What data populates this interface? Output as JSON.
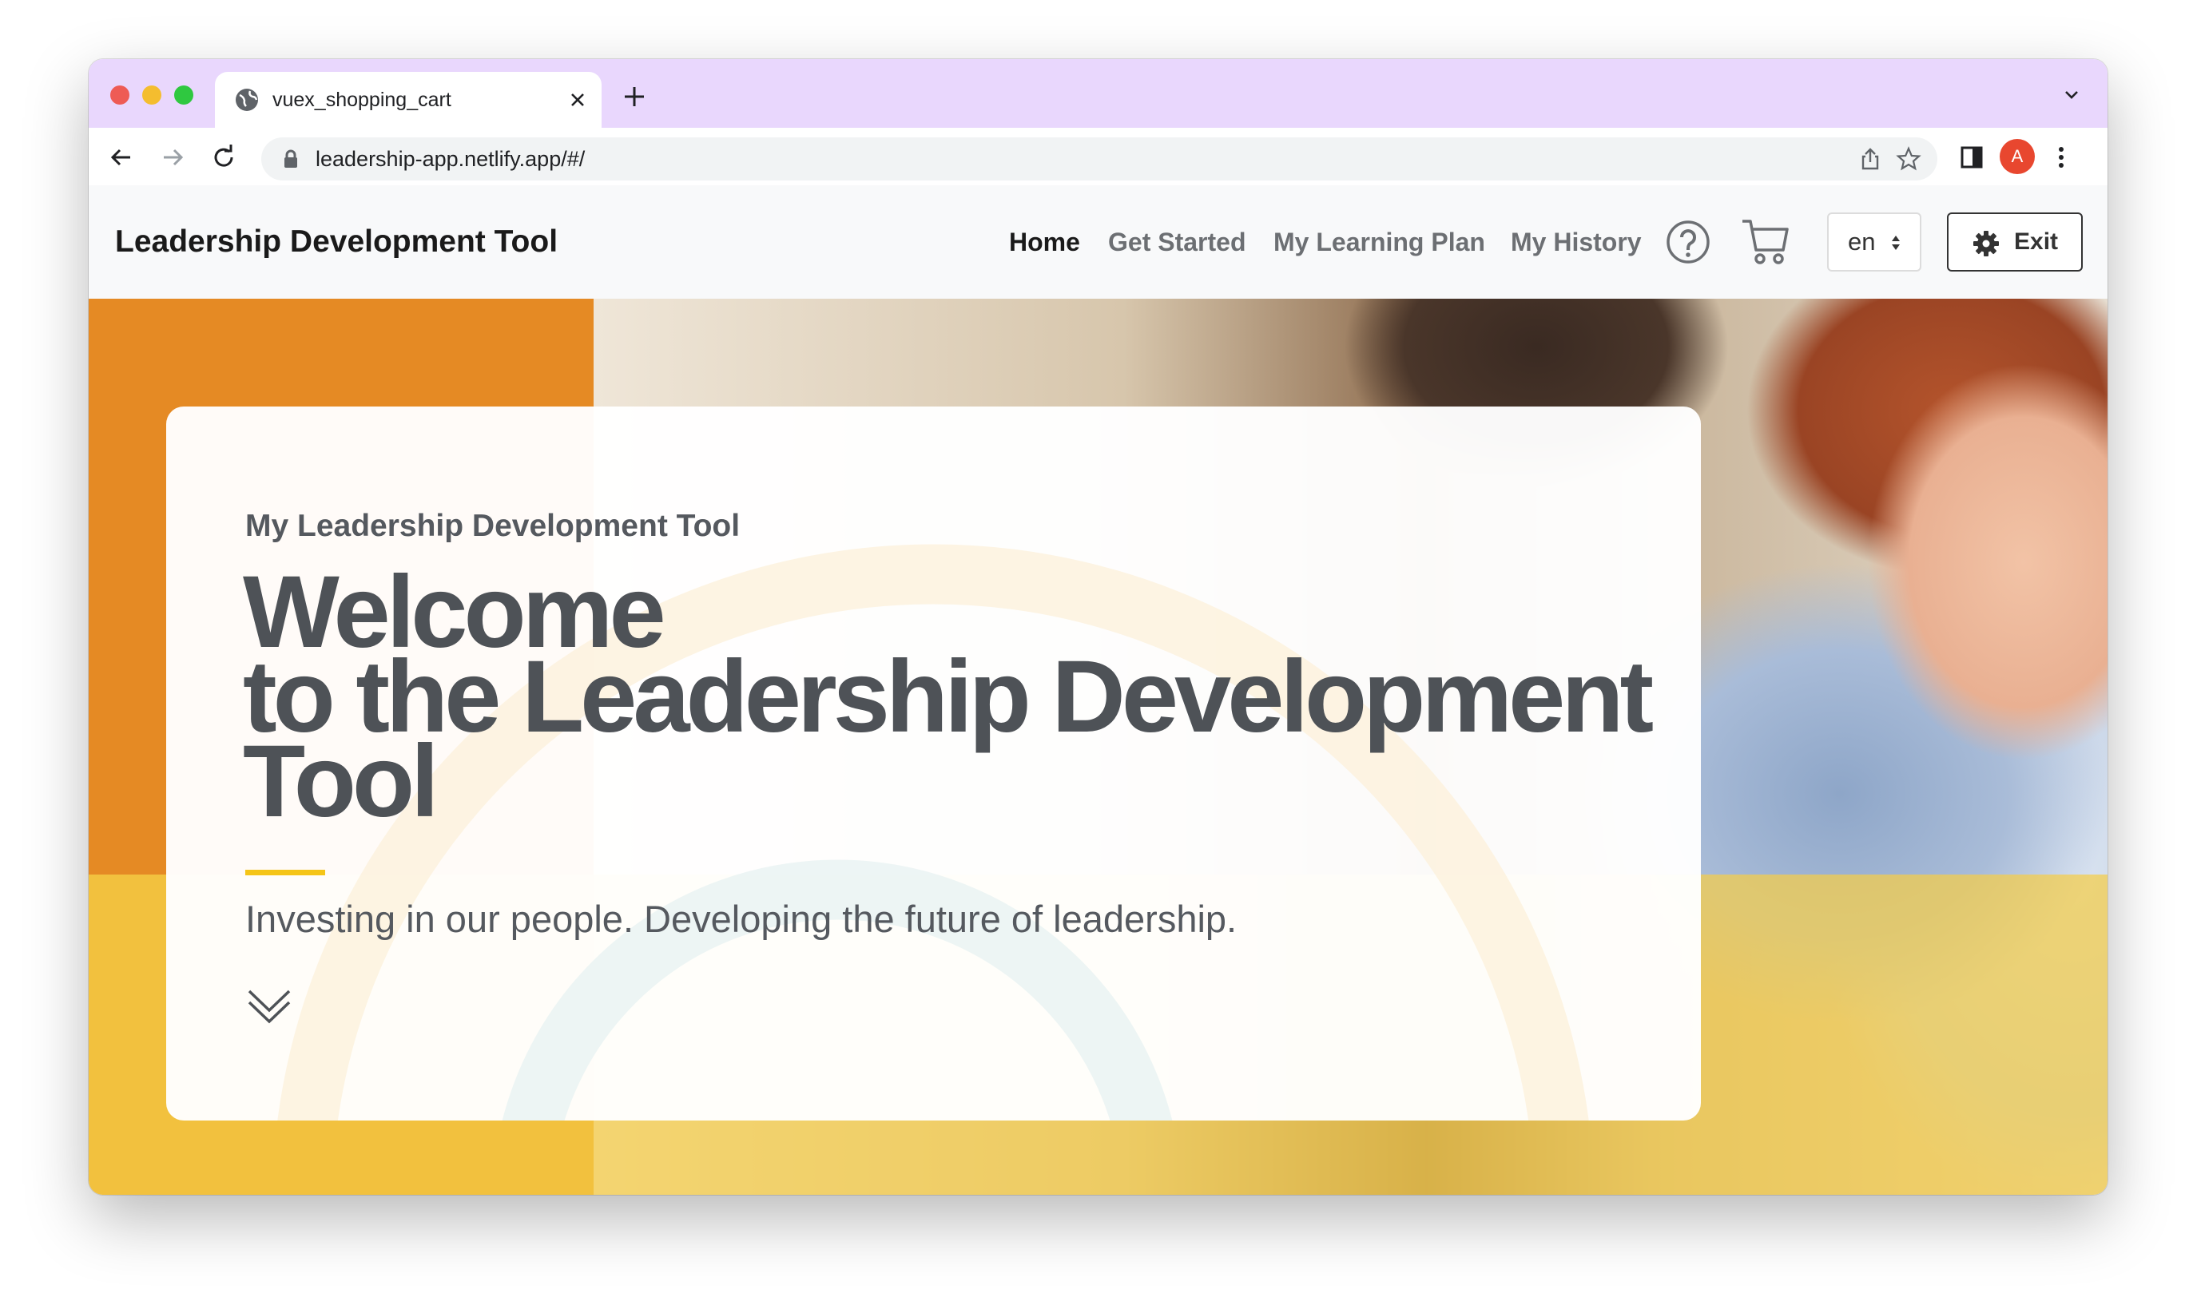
{
  "browser": {
    "tab_title": "vuex_shopping_cart",
    "url": "leadership-app.netlify.app/#/",
    "avatar_initial": "A"
  },
  "navbar": {
    "brand": "Leadership Development Tool",
    "links": [
      {
        "label": "Home",
        "active": true
      },
      {
        "label": "Get Started",
        "active": false
      },
      {
        "label": "My Learning Plan",
        "active": false
      },
      {
        "label": "My History",
        "active": false
      }
    ],
    "language": "en",
    "exit_label": "Exit"
  },
  "hero": {
    "eyebrow": "My Leadership Development Tool",
    "headline_line1": "Welcome",
    "headline_line2": "to the Leadership Development",
    "headline_line3": "Tool",
    "tagline": "Investing in our people. Developing the future of leadership."
  },
  "colors": {
    "tabstrip": "#e9d7fd",
    "orange": "#e58a24",
    "yellow": "#f2c13e",
    "accent": "#f5c518",
    "text_dark": "#4e5257"
  }
}
